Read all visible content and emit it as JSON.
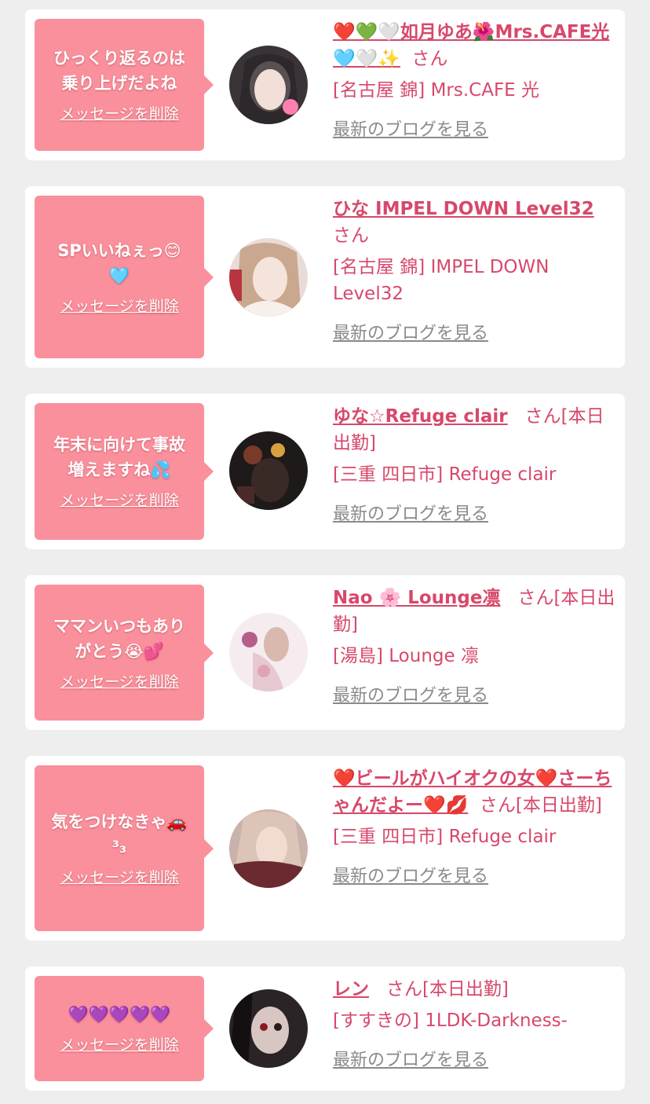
{
  "delete_label": "メッセージを削除",
  "blog_label": "最新のブログを見る",
  "san_label": "さん",
  "cards": [
    {
      "message": "ひっくり返るのは\n乗り上げだよね",
      "name": "❤️💚🤍如月ゆあ🌺Mrs.CAFE光🩵🤍✨",
      "suffix": "",
      "shop": "[名古屋 錦] Mrs.CAFE 光"
    },
    {
      "message": "SPいいねぇっ😊\n🩵",
      "name": "ひな IMPEL DOWN Level32",
      "suffix": "",
      "shop": "[名古屋 錦] IMPEL DOWN Level32"
    },
    {
      "message": "年末に向けて事故\n増えますね💦",
      "name": "ゆな☆Refuge clair",
      "suffix": "[本日出勤]",
      "shop": "[三重 四日市] Refuge clair"
    },
    {
      "message": "ママンいつもあり\nがとう😭💕",
      "name": "Nao 🌸 Lounge凛",
      "suffix": "[本日出勤]",
      "shop": "[湯島] Lounge 凛"
    },
    {
      "message": "気をつけなきゃ🚗\n³₃",
      "name": "❤️ビールがハイオクの女❤️さーちゃんだよー❤️💋",
      "suffix": "[本日出勤]",
      "shop": "[三重 四日市] Refuge clair"
    },
    {
      "message": "💜💜💜💜💜",
      "name": "レン",
      "suffix": "[本日出勤]",
      "shop": "[すすきの] 1LDK-Darkness-"
    }
  ],
  "colors": {
    "page_bg": "#eeeeee",
    "card_bg": "#ffffff",
    "bubble": "#f9909b",
    "accent": "#d7486a",
    "muted": "#8a8a8a"
  }
}
